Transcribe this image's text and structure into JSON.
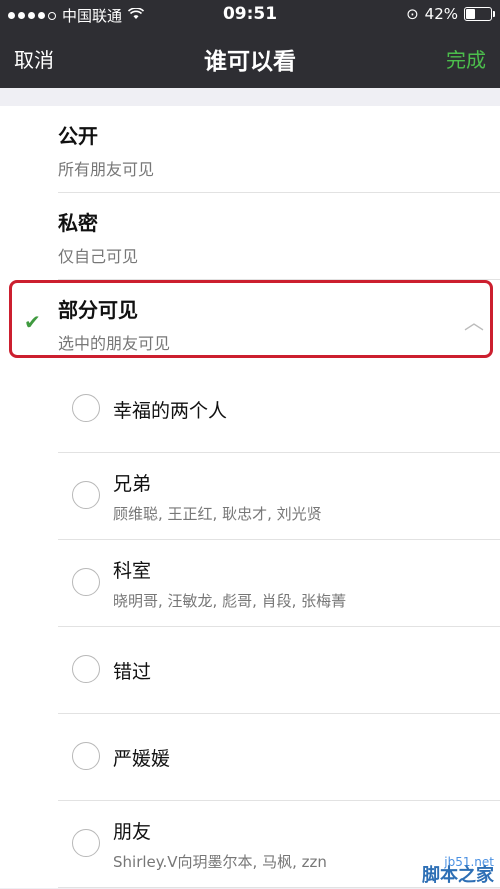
{
  "status_bar": {
    "carrier": "中国联通",
    "time": "09:51",
    "battery": "42%",
    "battery_level": 0.42
  },
  "nav": {
    "cancel": "取消",
    "title": "谁可以看",
    "done": "完成",
    "done_color": "#4cbe4c"
  },
  "options": [
    {
      "title": "公开",
      "subtitle": "所有朋友可见"
    },
    {
      "title": "私密",
      "subtitle": "仅自己可见"
    },
    {
      "title": "部分可见",
      "subtitle": "选中的朋友可见",
      "selected": true,
      "expanded": true
    }
  ],
  "groups": [
    {
      "name": "幸福的两个人",
      "members": ""
    },
    {
      "name": "兄弟",
      "members": "顾维聪, 王正红, 耿忠才, 刘光贤"
    },
    {
      "name": "科室",
      "members": "晓明哥, 汪敏龙, 彪哥, 肖段, 张梅菁"
    },
    {
      "name": "错过",
      "members": ""
    },
    {
      "name": "严媛媛",
      "members": ""
    },
    {
      "name": "朋友",
      "members": "Shirley.V向玥墨尔本, 马枫, zzn"
    }
  ],
  "watermark": {
    "site": "jb51.net",
    "name": "脚本之家"
  },
  "highlight_color": "#cc1f2f"
}
